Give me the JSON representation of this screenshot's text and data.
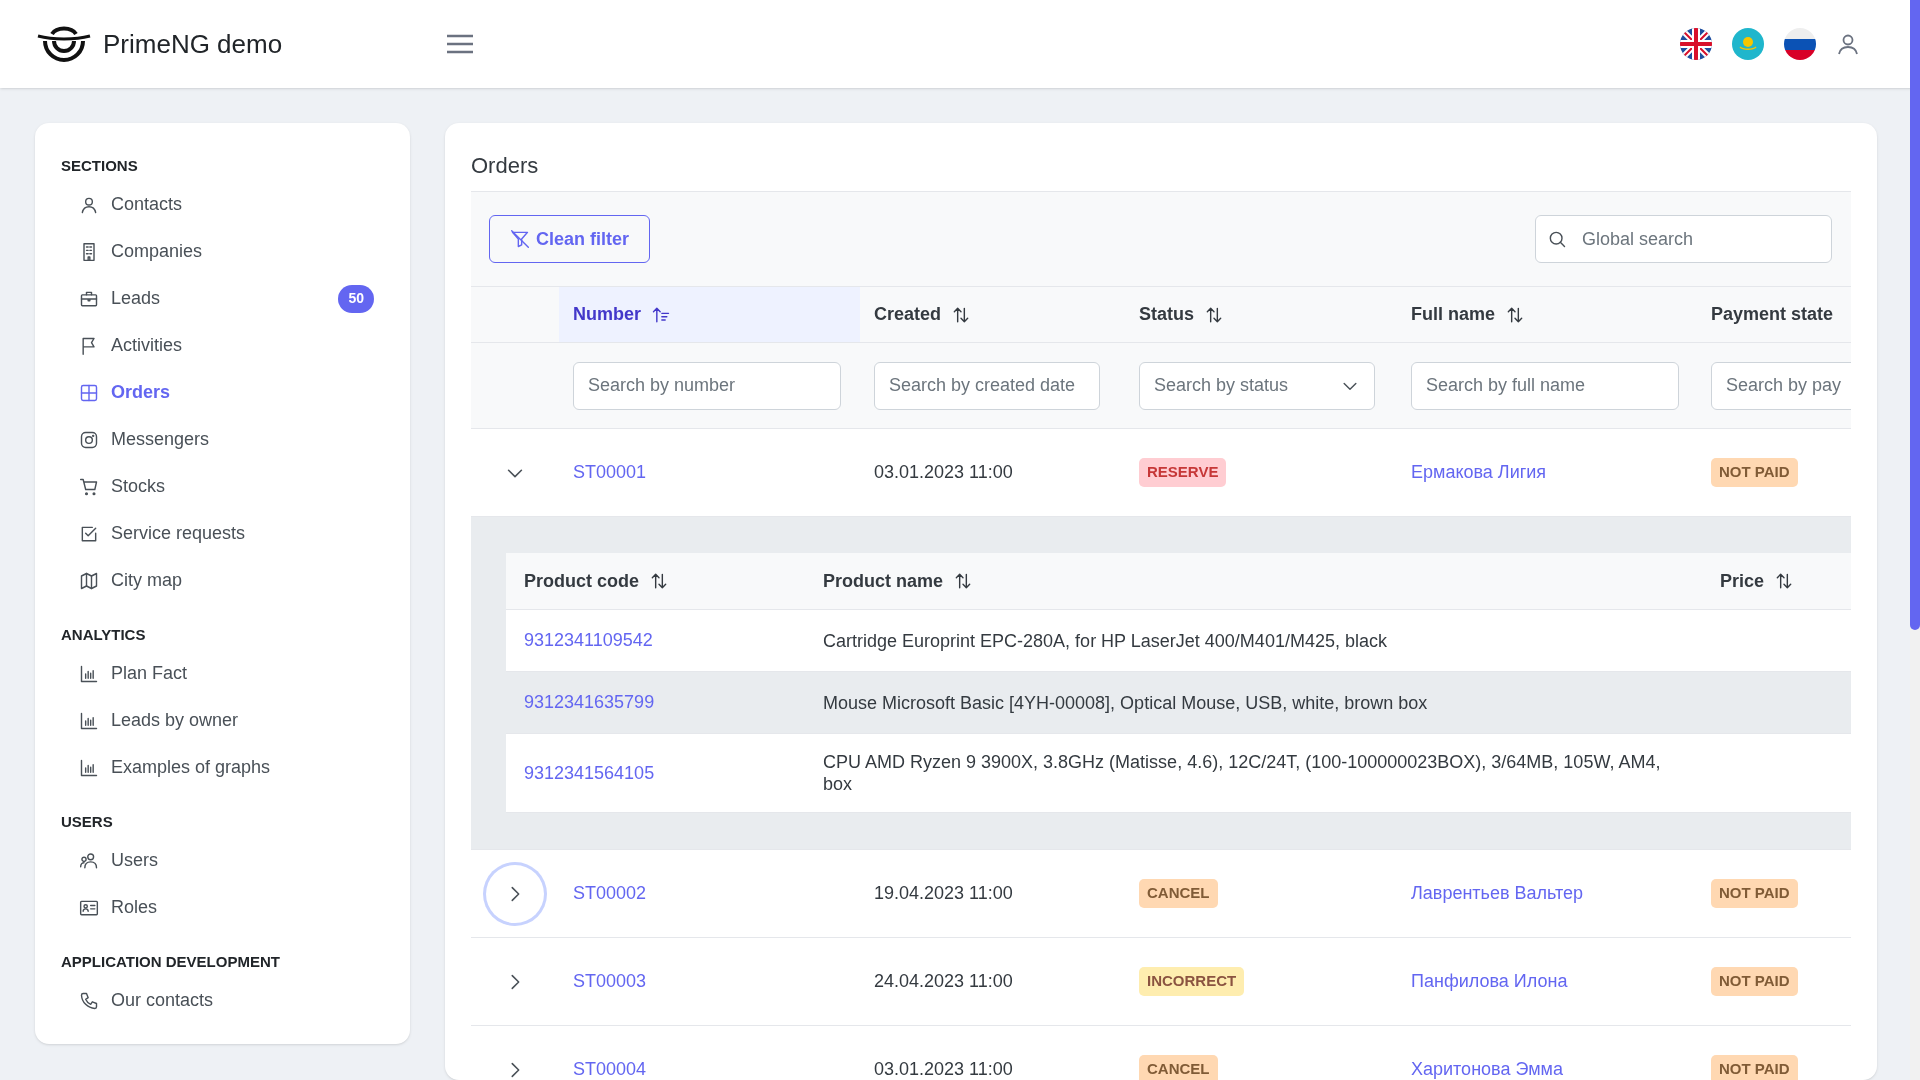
{
  "header": {
    "brand": "PrimeNG demo"
  },
  "sidebar": {
    "sections": [
      {
        "title": "SECTIONS",
        "items": [
          {
            "label": "Contacts",
            "selected": false
          },
          {
            "label": "Companies",
            "selected": false
          },
          {
            "label": "Leads",
            "selected": false,
            "badge": "50"
          },
          {
            "label": "Activities",
            "selected": false
          },
          {
            "label": "Orders",
            "selected": true
          },
          {
            "label": "Messengers",
            "selected": false
          },
          {
            "label": "Stocks",
            "selected": false
          },
          {
            "label": "Service requests",
            "selected": false
          },
          {
            "label": "City map",
            "selected": false
          }
        ]
      },
      {
        "title": "ANALYTICS",
        "items": [
          {
            "label": "Plan Fact",
            "selected": false
          },
          {
            "label": "Leads by owner",
            "selected": false
          },
          {
            "label": "Examples of graphs",
            "selected": false
          }
        ]
      },
      {
        "title": "USERS",
        "items": [
          {
            "label": "Users",
            "selected": false
          },
          {
            "label": "Roles",
            "selected": false
          }
        ]
      },
      {
        "title": "APPLICATION DEVELOPMENT",
        "items": [
          {
            "label": "Our contacts",
            "selected": false
          }
        ]
      }
    ]
  },
  "orders": {
    "title": "Orders",
    "clean_filter": "Clean filter",
    "global_search": {
      "placeholder": "Global search"
    },
    "columns": [
      {
        "label": "Number",
        "sorted": true,
        "filter": {
          "placeholder": "Search by number",
          "kind": "text"
        }
      },
      {
        "label": "Created",
        "sorted": false,
        "filter": {
          "placeholder": "Search by created date",
          "kind": "text"
        }
      },
      {
        "label": "Status",
        "sorted": false,
        "filter": {
          "placeholder": "Search by status",
          "kind": "dropdown"
        }
      },
      {
        "label": "Full name",
        "sorted": false,
        "filter": {
          "placeholder": "Search by full name",
          "kind": "text"
        }
      },
      {
        "label": "Payment state",
        "sorted": false,
        "filter": {
          "placeholder": "Search by pay",
          "kind": "text"
        }
      }
    ],
    "rows": [
      {
        "number": "ST00001",
        "created": "03.01.2023 11:00",
        "status": {
          "label": "RESERVE",
          "kind": "danger"
        },
        "full_name": "Ермакова Лигия",
        "payment": {
          "label": "NOT PAID",
          "kind": "warning"
        },
        "expanded": true,
        "focused": false,
        "products": {
          "columns": [
            "Product code",
            "Product name",
            "Price"
          ],
          "rows": [
            {
              "code": "9312341109542",
              "name": "Cartridge Europrint EPC-280A, for HP LaserJet 400/M401/M425, black",
              "highlighted": false
            },
            {
              "code": "9312341635799",
              "name": "Mouse Microsoft Basic [4YH-00008], Optical Mouse, USB, white, brown box",
              "highlighted": true
            },
            {
              "code": "9312341564105",
              "name": "CPU AMD Ryzen 9 3900X, 3.8GHz (Matisse, 4.6), 12C/24T, (100-100000023BOX), 3/64MB, 105W, AM4, box",
              "highlighted": false
            }
          ]
        }
      },
      {
        "number": "ST00002",
        "created": "19.04.2023 11:00",
        "status": {
          "label": "CANCEL",
          "kind": "warning"
        },
        "full_name": "Лаврентьев Вальтер",
        "payment": {
          "label": "NOT PAID",
          "kind": "warning"
        },
        "expanded": false,
        "focused": true
      },
      {
        "number": "ST00003",
        "created": "24.04.2023 11:00",
        "status": {
          "label": "INCORRECT",
          "kind": "caution"
        },
        "full_name": "Панфилова Илона",
        "payment": {
          "label": "NOT PAID",
          "kind": "warning"
        },
        "expanded": false,
        "focused": false
      },
      {
        "number": "ST00004",
        "created": "03.01.2023 11:00",
        "status": {
          "label": "CANCEL",
          "kind": "warning"
        },
        "full_name": "Харитонова Эмма",
        "payment": {
          "label": "NOT PAID",
          "kind": "warning"
        },
        "expanded": false,
        "focused": false
      }
    ]
  }
}
